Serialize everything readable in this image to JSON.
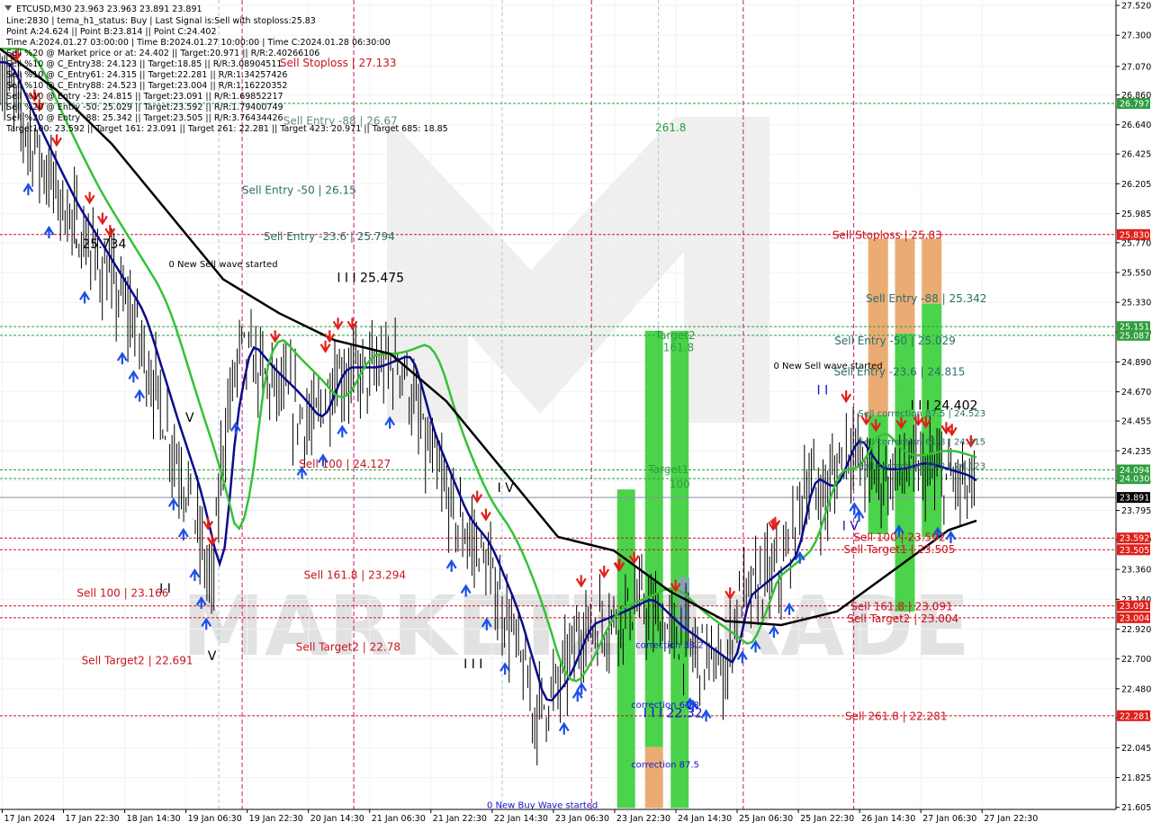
{
  "chart_data": {
    "type": "candlestick",
    "symbol_line": "ETCUSD,M30  23.963 23.963 23.891 23.891",
    "info_lines": [
      "Line:2830 | tema_h1_status: Buy | Last Signal is:Sell with stoploss:25.83",
      "Point A:24.624 || Point B:23.814 || Point C:24.402",
      "Time A:2024.01.27 03:00:00 | Time B:2024.01.27 10:00:00 | Time C:2024.01.28 06:30:00",
      "Sell %20 @ Market price or at: 24.402 || Target:20.971 || R/R:2.40266106",
      "Sell %10 @ C_Entry38: 24.123 || Target:18.85 || R/R:3.08904511",
      "Sell %10 @ C_Entry61: 24.315 || Target:22.281 || R/R:1.34257426",
      "Sell %10 @ C_Entry88: 24.523 || Target:23.004 || R/R:1.16220352",
      "Sell %10 @ Entry -23: 24.815 || Target:23.091 || R/R:1.69852217",
      "Sell %20 @ Entry -50: 25.029 || Target:23.592 || R/R:1.79400749",
      "Sell %20 @ Entry -88: 25.342 || Target:23.505 || R/R:3.76434426",
      "Target100: 23.592 || Target 161: 23.091 || Target 261: 22.281 || Target 423: 20.971 || Target 685: 18.85"
    ],
    "y_axis": {
      "ylim": [
        21.59,
        27.56
      ],
      "ticks": [
        "27.520",
        "27.300",
        "27.070",
        "26.860",
        "26.640",
        "26.425",
        "26.205",
        "25.985",
        "25.770",
        "25.550",
        "25.330",
        "25.110",
        "24.890",
        "24.670",
        "24.455",
        "24.235",
        "24.015",
        "23.795",
        "23.580",
        "23.360",
        "23.140",
        "22.920",
        "22.700",
        "22.480",
        "22.265",
        "22.045",
        "21.825",
        "21.605"
      ]
    },
    "x_axis": {
      "ticks": [
        "17 Jan 2024",
        "17 Jan 22:30",
        "18 Jan 14:30",
        "19 Jan 06:30",
        "19 Jan 22:30",
        "20 Jan 14:30",
        "21 Jan 06:30",
        "21 Jan 22:30",
        "22 Jan 14:30",
        "23 Jan 06:30",
        "23 Jan 22:30",
        "24 Jan 14:30",
        "25 Jan 06:30",
        "25 Jan 22:30",
        "26 Jan 14:30",
        "27 Jan 06:30",
        "27 Jan 22:30"
      ]
    },
    "current_price": {
      "value": 23.891,
      "label": "23.891"
    },
    "price_tags": [
      {
        "value": 26.797,
        "label": "26.797",
        "color": "#2e9e3e"
      },
      {
        "value": 25.83,
        "label": "25.830",
        "color": "#e0201b"
      },
      {
        "value": 25.151,
        "label": "25.151",
        "color": "#2e9e3e"
      },
      {
        "value": 25.087,
        "label": "25.087",
        "color": "#2e9e3e"
      },
      {
        "value": 24.094,
        "label": "24.094",
        "color": "#2e9e3e"
      },
      {
        "value": 24.03,
        "label": "24.030",
        "color": "#2e9e3e"
      },
      {
        "value": 23.592,
        "label": "23.592",
        "color": "#e0201b"
      },
      {
        "value": 23.505,
        "label": "23.505",
        "color": "#e0201b"
      },
      {
        "value": 23.091,
        "label": "23.091",
        "color": "#e0201b"
      },
      {
        "value": 23.004,
        "label": "23.004",
        "color": "#e0201b"
      },
      {
        "value": 22.281,
        "label": "22.281",
        "color": "#e0201b"
      }
    ],
    "hlines": [
      {
        "value": 26.797,
        "color": "#2e9e3e"
      },
      {
        "value": 25.83,
        "color": "#c8141e"
      },
      {
        "value": 25.151,
        "color": "#2e9e3e"
      },
      {
        "value": 25.087,
        "color": "#2e9e3e"
      },
      {
        "value": 24.094,
        "color": "#2e9e3e"
      },
      {
        "value": 24.03,
        "color": "#2e9e3e"
      },
      {
        "value": 23.592,
        "color": "#c8141e"
      },
      {
        "value": 23.505,
        "color": "#c8141e"
      },
      {
        "value": 23.091,
        "color": "#c8141e"
      },
      {
        "value": 23.004,
        "color": "#c8141e"
      },
      {
        "value": 22.281,
        "color": "#c8141e"
      }
    ],
    "annotations": [
      {
        "text": "Sell Stoploss | 27.133",
        "price": 27.07,
        "pos": 0.303,
        "color": "#c8141e"
      },
      {
        "text": "Sell Entry -88 | 26.67",
        "price": 26.64,
        "pos": 0.305,
        "color": "#6a8a84"
      },
      {
        "text": "261.8",
        "price": 26.59,
        "pos": 0.601,
        "color": "#2e9e3e"
      },
      {
        "text": "Sell Entry -50 | 26.15",
        "price": 26.13,
        "pos": 0.268,
        "color": "#2a6f6a"
      },
      {
        "text": "I 25.734",
        "price": 25.73,
        "pos": 0.09,
        "color": "#000000",
        "big": true
      },
      {
        "text": "Sell Entry -23.6 | 25.794",
        "price": 25.79,
        "pos": 0.295,
        "color": "#2a6f6a"
      },
      {
        "text": "0 New Sell wave started",
        "price": 25.59,
        "pos": 0.2,
        "color": "#000000",
        "small": true
      },
      {
        "text": "I I I 25.475",
        "price": 25.48,
        "pos": 0.332,
        "color": "#000000",
        "big": true
      },
      {
        "text": "Target2",
        "price": 25.06,
        "pos": 0.605,
        "color": "#2e9e3e"
      },
      {
        "text": "161.8",
        "price": 24.97,
        "pos": 0.608,
        "color": "#2e9e3e"
      },
      {
        "text": "V",
        "price": 24.45,
        "pos": 0.17,
        "color": "#000000",
        "big": true
      },
      {
        "text": "Sell 100 | 24.127",
        "price": 24.11,
        "pos": 0.309,
        "color": "#c8141e"
      },
      {
        "text": "Target1",
        "price": 24.07,
        "pos": 0.599,
        "color": "#2e9e3e"
      },
      {
        "text": "100",
        "price": 23.96,
        "pos": 0.609,
        "color": "#2e9e3e"
      },
      {
        "text": "I V",
        "price": 23.93,
        "pos": 0.453,
        "color": "#000000",
        "big": true
      },
      {
        "text": "Sell 161.8 | 23.294",
        "price": 23.29,
        "pos": 0.318,
        "color": "#c8141e"
      },
      {
        "text": "Sell 100 | 23.166",
        "price": 23.16,
        "pos": 0.11,
        "color": "#c8141e"
      },
      {
        "text": "I I",
        "price": 23.19,
        "pos": 0.148,
        "color": "#000000",
        "big": true
      },
      {
        "text": "Sell Target2 | 22.78",
        "price": 22.76,
        "pos": 0.312,
        "color": "#c8141e"
      },
      {
        "text": "V",
        "price": 22.69,
        "pos": 0.19,
        "color": "#000000",
        "big": true
      },
      {
        "text": "Sell Target2 | 22.691",
        "price": 22.66,
        "pos": 0.123,
        "color": "#c8141e"
      },
      {
        "text": "I I I",
        "price": 22.63,
        "pos": 0.424,
        "color": "#000000",
        "big": true
      },
      {
        "text": "correction 38.2",
        "price": 22.78,
        "pos": 0.6,
        "color": "#1515c8",
        "small": true
      },
      {
        "text": "correction 61.8",
        "price": 22.34,
        "pos": 0.596,
        "color": "#1515c8",
        "small": true
      },
      {
        "text": "I I I 22.32",
        "price": 22.27,
        "pos": 0.603,
        "color": "#1515c8",
        "big": true
      },
      {
        "text": "correction 87.5",
        "price": 21.9,
        "pos": 0.596,
        "color": "#1515c8",
        "small": true
      },
      {
        "text": "0 New Buy Wave started",
        "price": 21.6,
        "pos": 0.486,
        "color": "#1515c8",
        "small": true
      },
      {
        "text": "Sell Stoploss | 25.83",
        "price": 25.8,
        "pos": 0.795,
        "color": "#c8141e"
      },
      {
        "text": "Sell Entry -88 | 25.342",
        "price": 25.33,
        "pos": 0.83,
        "color": "#2a6f6a"
      },
      {
        "text": "Sell Entry -50 | 25.029",
        "price": 25.02,
        "pos": 0.802,
        "color": "#2a6f6a"
      },
      {
        "text": "0 New Sell wave started",
        "price": 24.84,
        "pos": 0.742,
        "color": "#000000",
        "small": true
      },
      {
        "text": "Sell Entry -23.6 | 24.815",
        "price": 24.79,
        "pos": 0.806,
        "color": "#2a6f6a"
      },
      {
        "text": "I I",
        "price": 24.65,
        "pos": 0.737,
        "color": "#1515c8",
        "big": true
      },
      {
        "text": "I I I 24.402",
        "price": 24.54,
        "pos": 0.846,
        "color": "#000000",
        "big": true
      },
      {
        "text": "Sell correction 87.5 | 24.523",
        "price": 24.49,
        "pos": 0.826,
        "color": "#2a6f6a",
        "small": true
      },
      {
        "text": "Sell correction 61.8 | 24.315",
        "price": 24.28,
        "pos": 0.826,
        "color": "#2a6f6a",
        "small": true
      },
      {
        "text": "Sell correction 38.2 | 24.123",
        "price": 24.1,
        "pos": 0.826,
        "color": "#2a6f6a",
        "small": true
      },
      {
        "text": "I V",
        "price": 23.65,
        "pos": 0.762,
        "color": "#1515c8",
        "big": true
      },
      {
        "text": "Sell 100 | 23.592",
        "price": 23.57,
        "pos": 0.806,
        "color": "#c8141e"
      },
      {
        "text": "Sell Target1 | 23.505",
        "price": 23.48,
        "pos": 0.806,
        "color": "#c8141e"
      },
      {
        "text": "Sell 161.8 | 23.091",
        "price": 23.06,
        "pos": 0.808,
        "color": "#c8141e"
      },
      {
        "text": "Sell Target2 | 23.004",
        "price": 22.97,
        "pos": 0.809,
        "color": "#c8141e"
      },
      {
        "text": "Sell 261.8 | 22.281",
        "price": 22.25,
        "pos": 0.803,
        "color": "#c8141e"
      }
    ],
    "watermark": "MARKETZITRADE",
    "colors": {
      "up_bar": "#000000",
      "ema_fast": "#0a0a8c",
      "ema_mid": "#35c235",
      "ema_slow": "#000000",
      "sell_arrow": "#e0201b",
      "buy_arrow": "#1a50e6",
      "green_bar": "#32cd32",
      "orange_bar": "#e8a060"
    }
  }
}
